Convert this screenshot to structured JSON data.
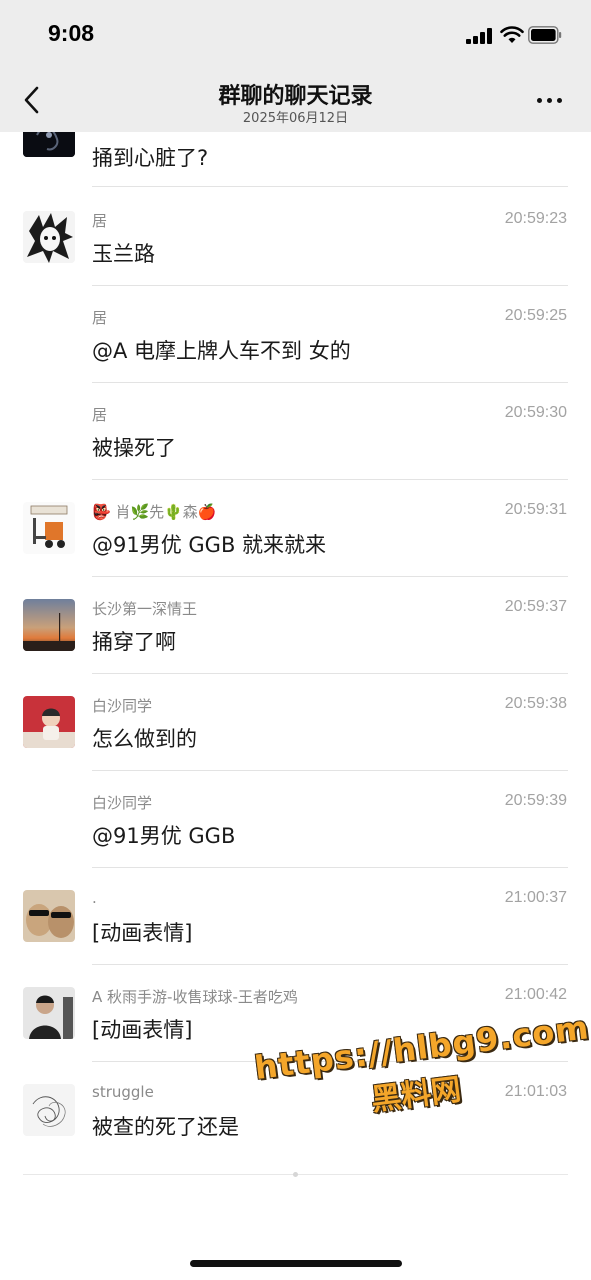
{
  "status_bar": {
    "time": "9:08"
  },
  "header": {
    "title": "群聊的聊天记录",
    "subtitle": "2025年06月12日",
    "back_icon": "chevron-left-icon",
    "more_icon": "ellipsis-icon"
  },
  "messages": [
    {
      "sender": "",
      "time": "",
      "text": "捅到心脏了?",
      "avatar": "dark-photo"
    },
    {
      "sender": "居",
      "time": "20:59:23",
      "text": "玉兰路",
      "avatar": "anime-sketch"
    },
    {
      "sender": "居",
      "time": "20:59:25",
      "text": "@A 电摩上牌人车不到 女的",
      "avatar": ""
    },
    {
      "sender": "居",
      "time": "20:59:30",
      "text": "被操死了",
      "avatar": ""
    },
    {
      "sender": "👺 肖🌿先🌵森🍎",
      "time": "20:59:31",
      "text": "@91男优 GGB 就来就来",
      "avatar": "forklift"
    },
    {
      "sender": "长沙第一深情王",
      "time": "20:59:37",
      "text": "捅穿了啊",
      "avatar": "sunset"
    },
    {
      "sender": "白沙同学",
      "time": "20:59:38",
      "text": "怎么做到的",
      "avatar": "red-room"
    },
    {
      "sender": "白沙同学",
      "time": "20:59:39",
      "text": "@91男优 GGB",
      "avatar": ""
    },
    {
      "sender": ".",
      "time": "21:00:37",
      "text": "[动画表情]",
      "avatar": "cats-sunglasses"
    },
    {
      "sender": "A 秋雨手游-收售球球-王者吃鸡",
      "time": "21:00:42",
      "text": "[动画表情]",
      "avatar": "man-portrait"
    },
    {
      "sender": "struggle",
      "time": "21:01:03",
      "text": "被查的死了还是",
      "avatar": "scribble"
    }
  ],
  "watermark": {
    "url": "https://hlbg9.com",
    "label": "黑料网"
  },
  "colors": {
    "header_bg": "#ededed",
    "divider": "#e3e3e3",
    "watermark": "#f4a62a"
  }
}
